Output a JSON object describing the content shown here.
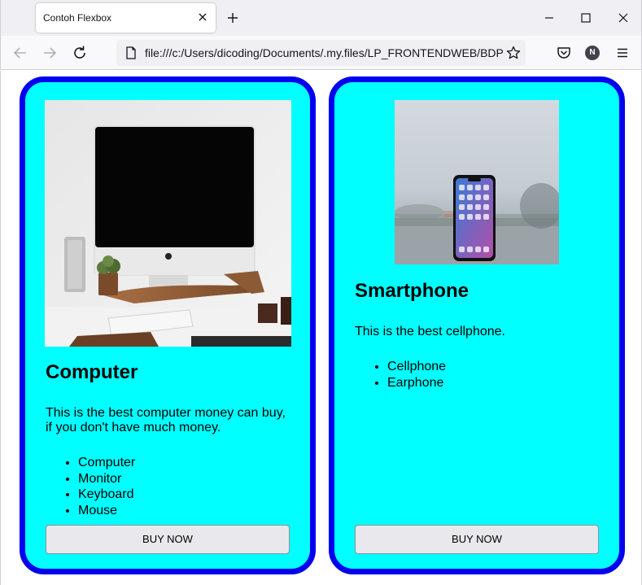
{
  "browser": {
    "tab_title": "Contoh Flexbox",
    "url": "file:///c:/Users/dicoding/Documents/.my.files/LP_FRONTENDWEB/BDPWEB",
    "profile_initial": "N"
  },
  "cards": [
    {
      "title": "Computer",
      "description": "This is the best computer money can buy, if you don't have much money.",
      "items": [
        "Computer",
        "Monitor",
        "Keyboard",
        "Mouse"
      ],
      "button_label": "BUY NOW"
    },
    {
      "title": "Smartphone",
      "description": "This is the best cellphone.",
      "items": [
        "Cellphone",
        "Earphone"
      ],
      "button_label": "BUY NOW"
    }
  ],
  "colors": {
    "card_background": "#00ffff",
    "card_border": "#0000ee",
    "button_background": "#e9e9ed"
  }
}
